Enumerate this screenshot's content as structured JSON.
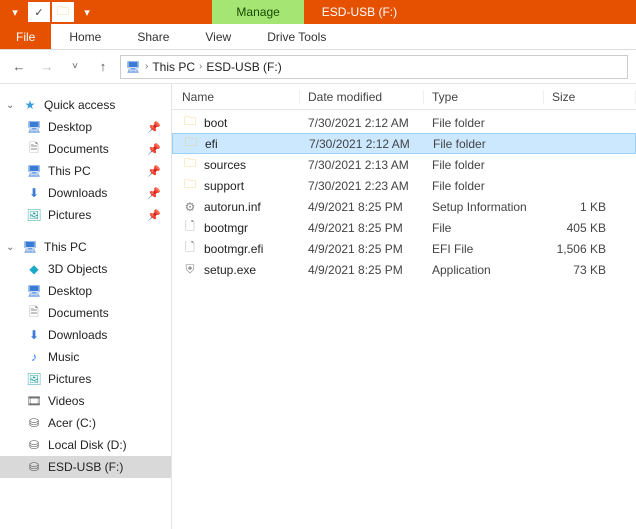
{
  "titlebar": {
    "context_tab": "Manage",
    "title": "ESD-USB (F:)"
  },
  "ribbon": {
    "file": "File",
    "tabs": [
      "Home",
      "Share",
      "View",
      "Drive Tools"
    ]
  },
  "breadcrumb": {
    "root_icon": "pc-icon",
    "crumbs": [
      "This PC",
      "ESD-USB (F:)"
    ]
  },
  "sidebar": {
    "quick_access": {
      "label": "Quick access",
      "items": [
        {
          "icon": "desktop",
          "label": "Desktop",
          "pinned": true
        },
        {
          "icon": "doc",
          "label": "Documents",
          "pinned": true
        },
        {
          "icon": "pc",
          "label": "This PC",
          "pinned": true
        },
        {
          "icon": "download",
          "label": "Downloads",
          "pinned": true
        },
        {
          "icon": "picture",
          "label": "Pictures",
          "pinned": true
        }
      ]
    },
    "this_pc": {
      "label": "This PC",
      "items": [
        {
          "icon": "threed",
          "label": "3D Objects"
        },
        {
          "icon": "desktop",
          "label": "Desktop"
        },
        {
          "icon": "doc",
          "label": "Documents"
        },
        {
          "icon": "download",
          "label": "Downloads"
        },
        {
          "icon": "music",
          "label": "Music"
        },
        {
          "icon": "picture",
          "label": "Pictures"
        },
        {
          "icon": "video",
          "label": "Videos"
        },
        {
          "icon": "drive",
          "label": "Acer (C:)"
        },
        {
          "icon": "drive",
          "label": "Local Disk (D:)"
        },
        {
          "icon": "drive",
          "label": "ESD-USB (F:)",
          "selected": true
        }
      ]
    }
  },
  "columns": {
    "name": "Name",
    "date": "Date modified",
    "type": "Type",
    "size": "Size"
  },
  "files": [
    {
      "icon": "folder",
      "name": "boot",
      "date": "7/30/2021 2:12 AM",
      "type": "File folder",
      "size": ""
    },
    {
      "icon": "folder",
      "name": "efi",
      "date": "7/30/2021 2:12 AM",
      "type": "File folder",
      "size": "",
      "selected": true
    },
    {
      "icon": "folder",
      "name": "sources",
      "date": "7/30/2021 2:13 AM",
      "type": "File folder",
      "size": ""
    },
    {
      "icon": "folder",
      "name": "support",
      "date": "7/30/2021 2:23 AM",
      "type": "File folder",
      "size": ""
    },
    {
      "icon": "inf",
      "name": "autorun.inf",
      "date": "4/9/2021 8:25 PM",
      "type": "Setup Information",
      "size": "1 KB"
    },
    {
      "icon": "file",
      "name": "bootmgr",
      "date": "4/9/2021 8:25 PM",
      "type": "File",
      "size": "405 KB"
    },
    {
      "icon": "file",
      "name": "bootmgr.efi",
      "date": "4/9/2021 8:25 PM",
      "type": "EFI File",
      "size": "1,506 KB"
    },
    {
      "icon": "exe",
      "name": "setup.exe",
      "date": "4/9/2021 8:25 PM",
      "type": "Application",
      "size": "73 KB"
    }
  ]
}
